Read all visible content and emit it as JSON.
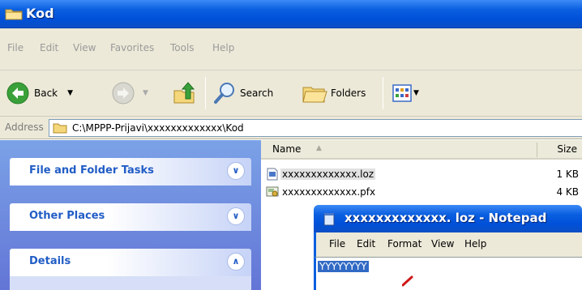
{
  "window": {
    "title": "Kod"
  },
  "menu": [
    "File",
    "Edit",
    "View",
    "Favorites",
    "Tools",
    "Help"
  ],
  "toolbar": {
    "back_label": "Back",
    "search_label": "Search",
    "folders_label": "Folders"
  },
  "address": {
    "label": "Address",
    "path": "C:\\MPPP-Prijavi\\xxxxxxxxxxxxx\\Kod"
  },
  "taskpane": {
    "panels": [
      {
        "label": "File and Folder Tasks",
        "state": "collapsed"
      },
      {
        "label": "Other Places",
        "state": "collapsed"
      },
      {
        "label": "Details",
        "state": "expanded"
      }
    ]
  },
  "filelist": {
    "columns": {
      "name": "Name",
      "size": "Size"
    },
    "rows": [
      {
        "name": "xxxxxxxxxxxxx.loz",
        "size": "1 KB"
      },
      {
        "name": "xxxxxxxxxxxxx.pfx",
        "size": "4 KB"
      }
    ]
  },
  "notepad": {
    "title": "xxxxxxxxxxxxx. loz - Notepad",
    "menu": [
      "File",
      "Edit",
      "Format",
      "View",
      "Help"
    ],
    "content": "YYYYYYYY"
  },
  "colors": {
    "xp_blue": "#0a5fe0",
    "pane_blue": "#7ba2e7",
    "link_blue": "#215dc6",
    "selection": "#316ac5"
  }
}
